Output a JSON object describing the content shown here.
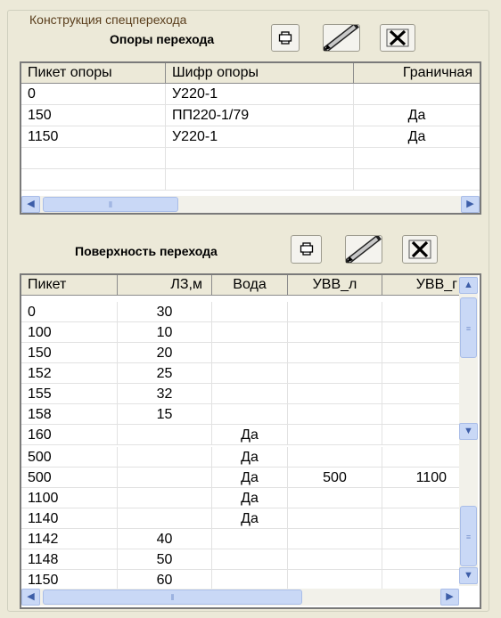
{
  "group": {
    "title": "Конструкция спецперехода"
  },
  "supports": {
    "title": "Опоры перехода",
    "columns": [
      "Пикет опоры",
      "Шифр опоры",
      "Граничная"
    ],
    "rows": [
      [
        "0",
        "У220-1",
        ""
      ],
      [
        "150",
        "ПП220-1/79",
        "Да"
      ],
      [
        "1150",
        "У220-1",
        "Да"
      ]
    ]
  },
  "surface": {
    "title": "Поверхность перехода",
    "columns": [
      "Пикет",
      "ЛЗ,м",
      "Вода",
      "УВВ_л",
      "УВВ_г"
    ],
    "rows_top": [
      [
        "0",
        "30",
        "",
        "",
        ""
      ],
      [
        "100",
        "10",
        "",
        "",
        ""
      ],
      [
        "150",
        "20",
        "",
        "",
        ""
      ],
      [
        "152",
        "25",
        "",
        "",
        ""
      ],
      [
        "155",
        "32",
        "",
        "",
        ""
      ],
      [
        "158",
        "15",
        "",
        "",
        ""
      ],
      [
        "160",
        "",
        "Да",
        "",
        ""
      ]
    ],
    "rows_bottom": [
      [
        "500",
        "",
        "Да",
        "",
        ""
      ],
      [
        "500",
        "",
        "Да",
        "500",
        "1100"
      ],
      [
        "1100",
        "",
        "Да",
        "",
        ""
      ],
      [
        "1140",
        "",
        "Да",
        "",
        ""
      ],
      [
        "1142",
        "40",
        "",
        "",
        ""
      ],
      [
        "1148",
        "50",
        "",
        "",
        ""
      ],
      [
        "1150",
        "60",
        "",
        "",
        ""
      ]
    ]
  },
  "icons": {
    "add": "plus-icon",
    "edit": "pencil-icon",
    "delete": "x-icon",
    "scroll_left": "arrow-left-icon",
    "scroll_right": "arrow-right-icon",
    "scroll_up": "arrow-up-icon",
    "scroll_down": "arrow-down-icon"
  },
  "colors": {
    "background": "#ece9d8",
    "group_title": "#5a3e1c",
    "scrollbar": "#c9d8f6"
  }
}
